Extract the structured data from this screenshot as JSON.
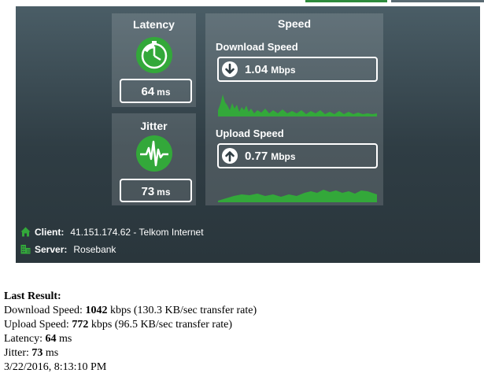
{
  "latency": {
    "title": "Latency",
    "value": "64",
    "unit": "ms",
    "icon": "stopwatch-icon"
  },
  "jitter": {
    "title": "Jitter",
    "value": "73",
    "unit": "ms",
    "icon": "waveform-icon"
  },
  "speed": {
    "title": "Speed",
    "download": {
      "label": "Download Speed",
      "value": "1.04",
      "unit": "Mbps",
      "icon": "arrow-down-icon"
    },
    "upload": {
      "label": "Upload Speed",
      "value": "0.77",
      "unit": "Mbps",
      "icon": "arrow-up-icon"
    }
  },
  "info": {
    "client_label": "Client:",
    "client_value": "41.151.174.62 - Telkom Internet",
    "client_icon": "home-icon",
    "server_label": "Server:",
    "server_value": "Rosebank",
    "server_icon": "building-icon"
  },
  "result": {
    "heading": "Last Result:",
    "download_prefix": "Download Speed: ",
    "download_value": "1042",
    "download_suffix": " kbps (130.3 KB/sec transfer rate)",
    "upload_prefix": "Upload Speed: ",
    "upload_value": "772",
    "upload_suffix": " kbps (96.5 KB/sec transfer rate)",
    "latency_prefix": "Latency: ",
    "latency_value": "64",
    "latency_suffix": " ms",
    "jitter_prefix": "Jitter: ",
    "jitter_value": "73",
    "jitter_suffix": " ms",
    "timestamp": "3/22/2016, 8:13:10 PM"
  },
  "colors": {
    "accent": "#33a83a",
    "panel_bg": "#3b4a52"
  }
}
